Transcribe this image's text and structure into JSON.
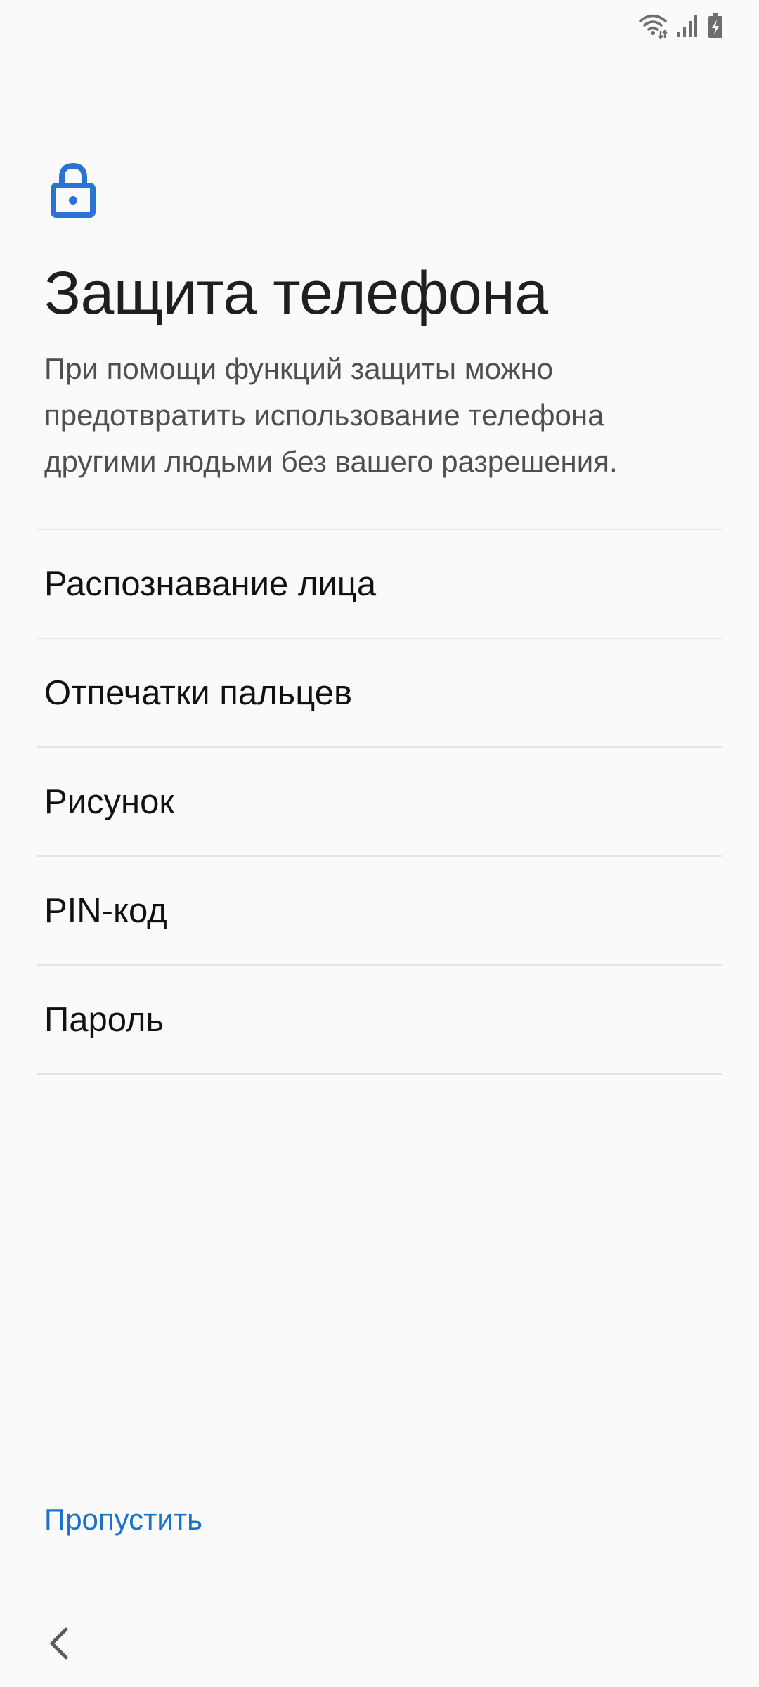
{
  "status_bar": {
    "icons": [
      "wifi-icon",
      "signal-icon",
      "battery-charging-icon"
    ]
  },
  "header": {
    "icon": "lock-icon",
    "title": "Защита телефона",
    "description": "При помощи функций защиты можно предотвратить использование телефона другими людьми без вашего разрешения."
  },
  "options": [
    {
      "label": "Распознавание лица"
    },
    {
      "label": "Отпечатки пальцев"
    },
    {
      "label": "Рисунок"
    },
    {
      "label": "PIN-код"
    },
    {
      "label": "Пароль"
    }
  ],
  "footer": {
    "skip_label": "Пропустить",
    "back_icon": "chevron-left-icon"
  },
  "colors": {
    "accent": "#1a73c9",
    "lock_icon": "#2a72d4",
    "background": "#fafafa"
  }
}
